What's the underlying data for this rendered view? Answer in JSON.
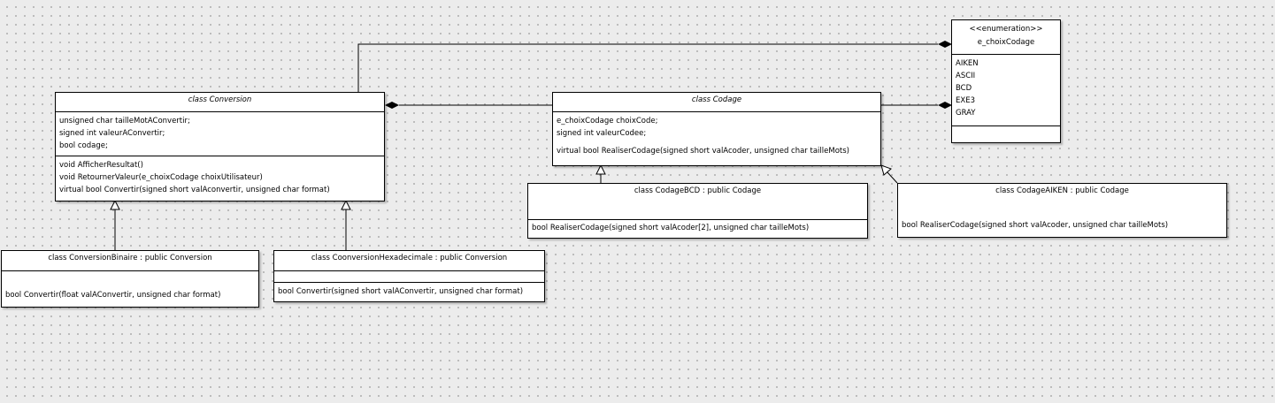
{
  "classes": {
    "conversion": {
      "title": "class Conversion",
      "attributes": [
        "unsigned char tailleMotAConvertir;",
        "signed int valeurAConvertir;",
        "bool codage;"
      ],
      "methods": [
        "void AfficherResultat()",
        "void RetournerValeur(e_choixCodage choixUtilisateur)",
        "virtual bool Convertir(signed short valAconvertir, unsigned char format)"
      ]
    },
    "codage": {
      "title": "class Codage",
      "attributes": [
        "e_choixCodage choixCode;",
        "signed int valeurCodee;"
      ],
      "methods": [
        "virtual bool RealiserCodage(signed short valAcoder, unsigned char tailleMots)"
      ]
    },
    "enumeration": {
      "stereotype": "<<enumeration>>",
      "name": "e_choixCodage",
      "values": [
        "AIKEN",
        "ASCII",
        "BCD",
        "EXE3",
        "GRAY"
      ]
    },
    "conversionBinaire": {
      "title": "class ConversionBinaire : public Conversion",
      "methods": [
        "bool Convertir(float valAConvertir, unsigned char format)"
      ]
    },
    "conversionHexadecimale": {
      "title": "class CoonversionHexadecimale : public Conversion",
      "methods": [
        "bool Convertir(signed short valAConvertir, unsigned char format)"
      ]
    },
    "codageBCD": {
      "title": "class CodageBCD  : public Codage",
      "methods": [
        "bool RealiserCodage(signed short valAcoder[2], unsigned char tailleMots)"
      ]
    },
    "codageAIKEN": {
      "title": "class CodageAIKEN : public Codage",
      "methods": [
        "bool RealiserCodage(signed short valAcoder, unsigned char tailleMots)"
      ]
    }
  }
}
